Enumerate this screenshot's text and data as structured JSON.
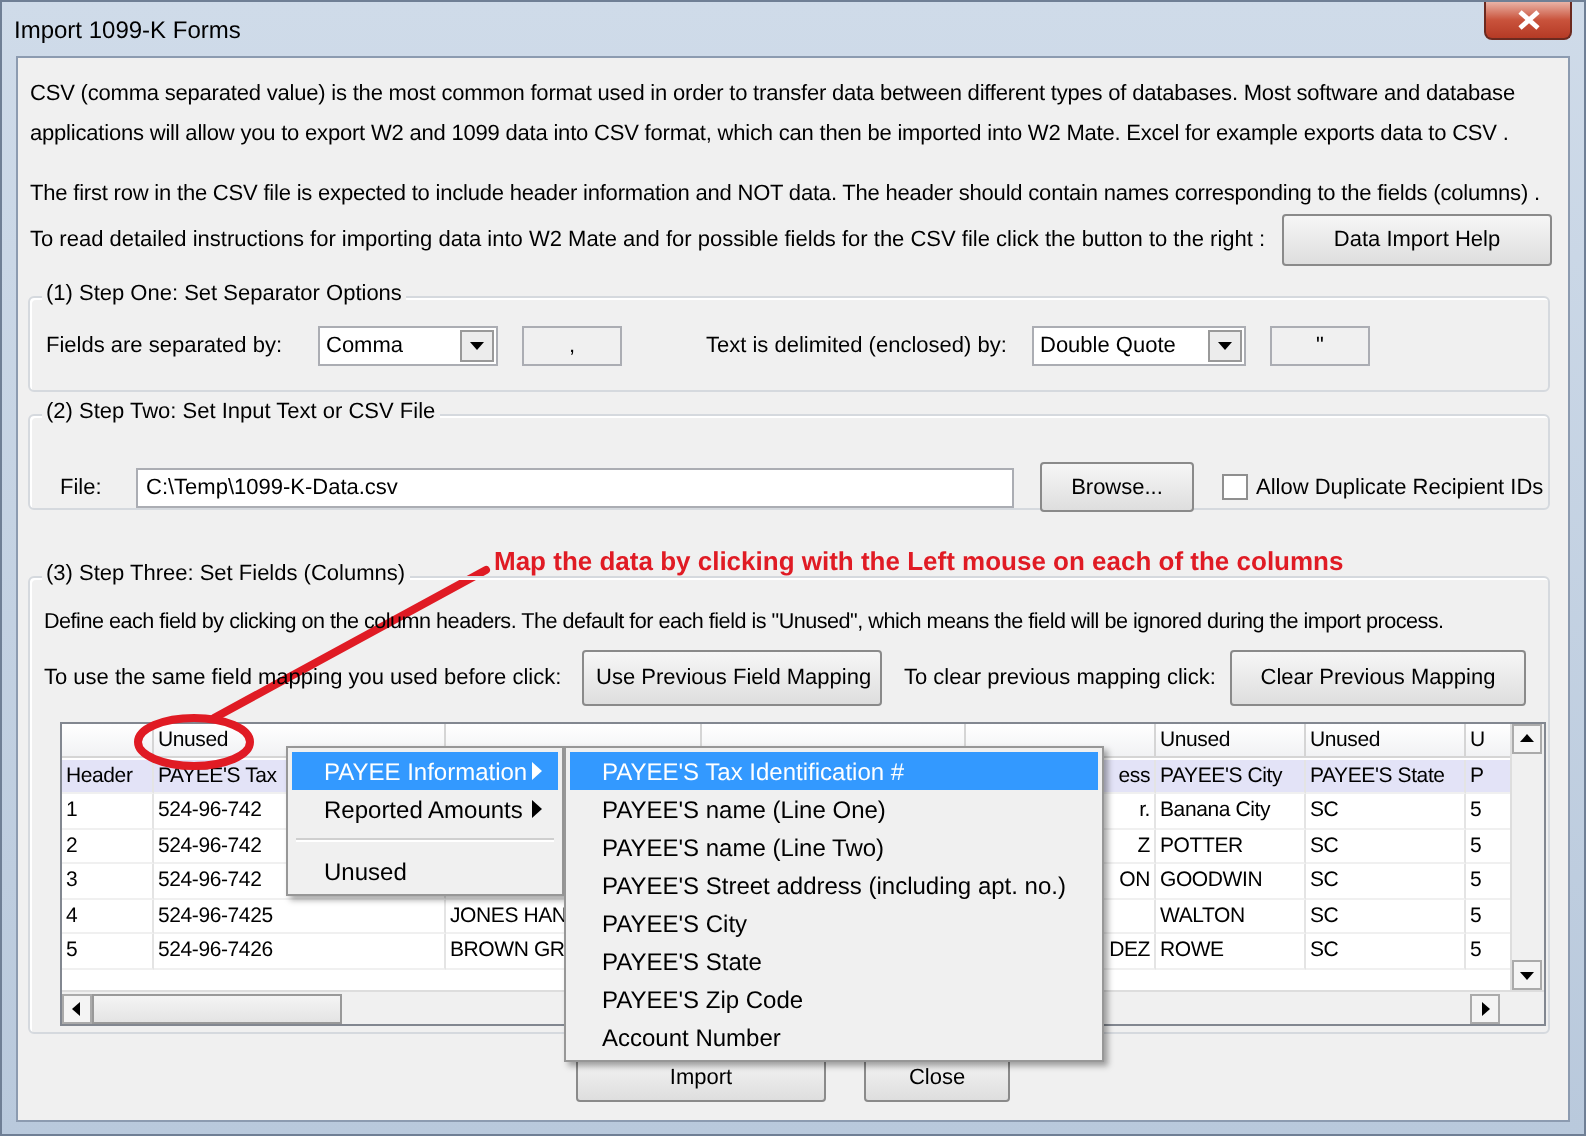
{
  "window": {
    "title": "Import 1099-K Forms"
  },
  "intro": [
    "CSV (comma separated value) is the most common format used in order to transfer data between different types of databases.  Most software and database applications will allow you to export W2 and 1099 data into CSV format, which can then be imported into W2 Mate. Excel for example exports data to CSV .",
    "The first row in the CSV file is expected to include header information and NOT data. The header should contain names corresponding to the fields (columns) ."
  ],
  "help_row": {
    "text": "To read detailed instructions for importing data into W2 Mate and for possible fields for the CSV file click the button to the right :",
    "button": "Data Import Help"
  },
  "step_one": {
    "title": "(1)  Step One: Set Separator Options",
    "separator_label": "Fields are separated by:",
    "separator_select": "Comma",
    "separator_char": ",",
    "delimiter_label": "Text is delimited (enclosed) by:",
    "delimiter_select": "Double Quote",
    "delimiter_char": "\""
  },
  "step_two": {
    "title": "(2)  Step Two: Set Input Text or CSV File",
    "file_label": "File:",
    "file_value": "C:\\Temp\\1099-K-Data.csv",
    "browse_button": "Browse...",
    "allow_duplicates": {
      "label": "Allow Duplicate Recipient IDs",
      "checked": false
    }
  },
  "annotation": {
    "text": "Map the data by clicking with the Left mouse on each of the columns"
  },
  "step_three": {
    "title": "(3)  Step Three: Set Fields (Columns)",
    "description": "Define each field by clicking on the column headers. The default for each field is \"Unused\", which means the field will be ignored during the import process.",
    "previous_label": "To use the same field mapping you used before click:",
    "previous_button": "Use Previous Field Mapping",
    "clear_label": "To clear previous mapping click:",
    "clear_button": "Clear Previous Mapping"
  },
  "grid": {
    "columns": [
      null,
      "Unused",
      null,
      null,
      null,
      "Unused",
      "Unused",
      "U"
    ],
    "rows": [
      {
        "kind": "header",
        "cells": [
          "Header",
          "PAYEE'S Tax",
          null,
          null,
          "ess",
          "PAYEE'S City",
          "PAYEE'S State",
          "P"
        ]
      },
      {
        "kind": "data",
        "cells": [
          "1",
          "524-96-742",
          null,
          null,
          "r.",
          "Banana City",
          "SC",
          "5"
        ]
      },
      {
        "kind": "data",
        "cells": [
          "2",
          "524-96-742",
          null,
          null,
          "Z",
          "POTTER",
          "SC",
          "5"
        ]
      },
      {
        "kind": "data",
        "cells": [
          "3",
          "524-96-742",
          null,
          null,
          "ON",
          "GOODWIN",
          "SC",
          "5"
        ]
      },
      {
        "kind": "data",
        "cells": [
          "4",
          "524-96-7425",
          "JONES HAN",
          null,
          null,
          "WALTON",
          "SC",
          "5"
        ]
      },
      {
        "kind": "data",
        "cells": [
          "5",
          "524-96-7426",
          "BROWN GR",
          null,
          "DEZ",
          "ROWE",
          "SC",
          "5"
        ]
      }
    ]
  },
  "menus": [
    {
      "items": [
        {
          "kind": "item",
          "label": "PAYEE Information",
          "submenu": true,
          "selected": true
        },
        {
          "kind": "item",
          "label": "Reported Amounts",
          "submenu": true,
          "selected": false
        },
        {
          "kind": "separator"
        },
        {
          "kind": "item",
          "label": "Unused",
          "submenu": false,
          "selected": false
        }
      ]
    },
    {
      "items": [
        {
          "kind": "item",
          "label": "PAYEE'S Tax Identification #",
          "submenu": false,
          "selected": true
        },
        {
          "kind": "item",
          "label": "PAYEE'S name (Line One)",
          "submenu": false,
          "selected": false
        },
        {
          "kind": "item",
          "label": "PAYEE'S name (Line Two)",
          "submenu": false,
          "selected": false
        },
        {
          "kind": "item",
          "label": "PAYEE'S Street address (including apt. no.)",
          "submenu": false,
          "selected": false
        },
        {
          "kind": "item",
          "label": "PAYEE'S City",
          "submenu": false,
          "selected": false
        },
        {
          "kind": "item",
          "label": "PAYEE'S State",
          "submenu": false,
          "selected": false
        },
        {
          "kind": "item",
          "label": "PAYEE'S Zip Code",
          "submenu": false,
          "selected": false
        },
        {
          "kind": "item",
          "label": "Account Number",
          "submenu": false,
          "selected": false
        }
      ]
    }
  ],
  "buttons": [
    "Import",
    "Close"
  ]
}
